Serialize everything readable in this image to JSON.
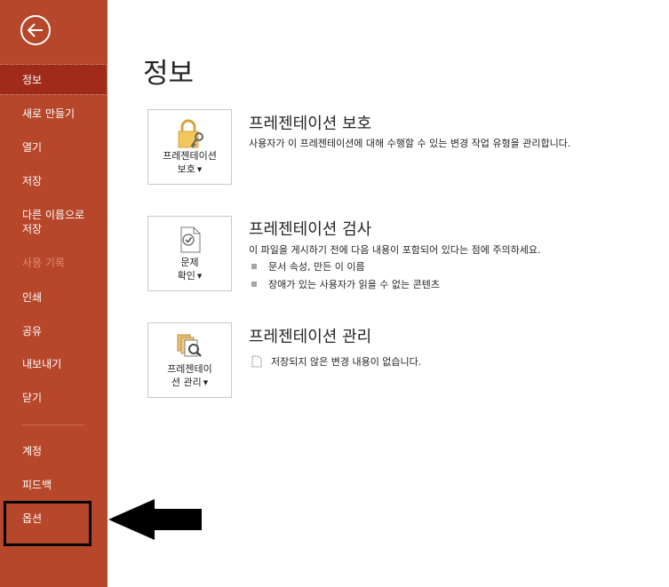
{
  "sidebar": {
    "back_icon": "back-arrow-icon",
    "items": [
      {
        "label": "정보",
        "state": "active"
      },
      {
        "label": "새로 만들기"
      },
      {
        "label": "열기"
      },
      {
        "label": "저장"
      },
      {
        "label": "다른 이름으로\n저장"
      },
      {
        "label": "사용 기록",
        "state": "disabled"
      },
      {
        "label": "인쇄"
      },
      {
        "label": "공유"
      },
      {
        "label": "내보내기"
      },
      {
        "label": "닫기"
      },
      {
        "label": "계정"
      },
      {
        "label": "피드백"
      },
      {
        "label": "옵션"
      }
    ]
  },
  "main": {
    "title": "정보",
    "protect": {
      "card_line1": "프레젠테이션",
      "card_line2": "보호",
      "title": "프레젠테이션 보호",
      "desc": "사용자가 이 프레젠테이션에 대해 수행할 수 있는 변경 작업 유형을 관리합니다."
    },
    "inspect": {
      "card_line1": "문제",
      "card_line2": "확인",
      "title": "프레젠테이션 검사",
      "desc": "이 파일을 게시하기 전에 다음 내용이 포함되어 있다는 점에 주의하세요.",
      "bullets": [
        "문서 속성, 만든 이 이름",
        "장애가 있는 사용자가 읽을 수 없는 콘텐츠"
      ]
    },
    "manage": {
      "card_line1": "프레젠테이",
      "card_line2": "션 관리",
      "title": "프레젠테이션 관리",
      "desc": "저장되지 않은 변경 내용이 없습니다."
    }
  },
  "colors": {
    "sidebar": "#b7472a",
    "sidebar_active": "#a02b1a",
    "highlight": "#000000"
  }
}
